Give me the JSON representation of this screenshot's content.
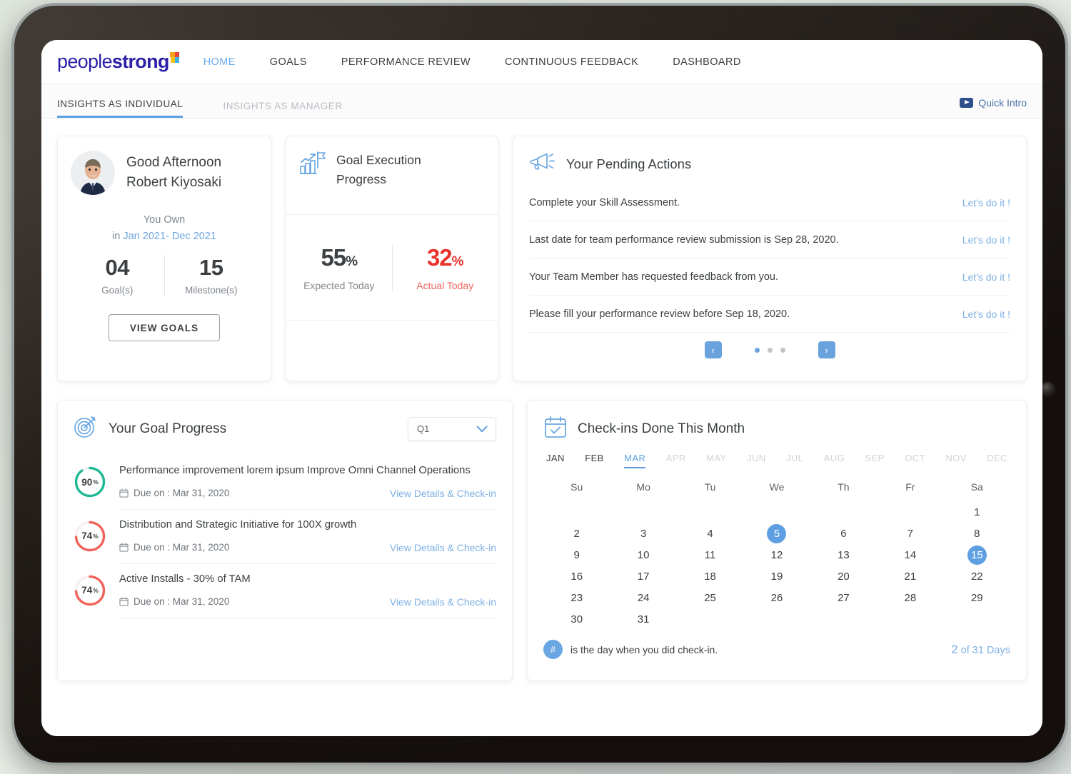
{
  "nav": {
    "logo": {
      "light": "people",
      "bold": "strong"
    },
    "items": [
      {
        "label": "HOME",
        "active": true
      },
      {
        "label": "GOALS",
        "active": false
      },
      {
        "label": "PERFORMANCE REVIEW",
        "active": false
      },
      {
        "label": "CONTINUOUS FEEDBACK",
        "active": false
      },
      {
        "label": "DASHBOARD",
        "active": false
      }
    ]
  },
  "subtabs": {
    "items": [
      {
        "label": "INSIGHTS AS INDIVIDUAL",
        "active": true
      },
      {
        "label": "INSIGHTS AS MANAGER",
        "active": false
      }
    ],
    "quick_intro": "Quick Intro"
  },
  "greeting": {
    "salutation": "Good Afternoon",
    "name": "Robert Kiyosaki",
    "you_own": "You Own",
    "period_prefix": "in ",
    "period": "Jan 2021- Dec 2021",
    "stats": [
      {
        "value": "04",
        "label": "Goal(s)"
      },
      {
        "value": "15",
        "label": "Milestone(s)"
      }
    ],
    "view_goals": "VIEW GOALS"
  },
  "goal_execution": {
    "title_line1": "Goal Execution",
    "title_line2": "Progress",
    "expected": {
      "value": "55",
      "pct": "%",
      "label": "Expected Today"
    },
    "actual": {
      "value": "32",
      "pct": "%",
      "label": "Actual Today",
      "color": "#e8322b"
    }
  },
  "pending_actions": {
    "title": "Your Pending Actions",
    "items": [
      {
        "text": "Complete your Skill Assessment.",
        "link": "Let's do it !"
      },
      {
        "text": "Last date for team performance review submission is Sep 28, 2020.",
        "link": "Let's do it !"
      },
      {
        "text": "Your Team Member has requested feedback from you.",
        "link": "Let's do it !"
      },
      {
        "text": "Please fill your performance review before Sep 18, 2020.",
        "link": "Let's do it !"
      }
    ],
    "prev": "‹",
    "next": "›",
    "dots": 3,
    "active_dot": 0
  },
  "goal_progress": {
    "title": "Your Goal Progress",
    "quarter": "Q1",
    "goals": [
      {
        "percent": 90,
        "percent_label": "90",
        "pct_sign": "%",
        "color": "#1fb894",
        "title": "Performance improvement lorem ipsum Improve Omni Channel Operations",
        "due": "Due on : Mar 31, 2020",
        "link": "View Details & Check-in"
      },
      {
        "percent": 74,
        "percent_label": "74",
        "pct_sign": "%",
        "color": "#f0635c",
        "title": "Distribution and Strategic Initiative for 100X growth",
        "due": "Due on : Mar 31, 2020",
        "link": "View Details & Check-in"
      },
      {
        "percent": 74,
        "percent_label": "74",
        "pct_sign": "%",
        "color": "#f0635c",
        "title": "Active Installs - 30% of TAM",
        "due": "Due on : Mar 31, 2020",
        "link": "View Details & Check-in"
      }
    ]
  },
  "checkins": {
    "title": "Check-ins Done This Month",
    "months": [
      {
        "label": "JAN",
        "state": "past"
      },
      {
        "label": "FEB",
        "state": "past"
      },
      {
        "label": "MAR",
        "state": "active"
      },
      {
        "label": "APR",
        "state": "future"
      },
      {
        "label": "MAY",
        "state": "future"
      },
      {
        "label": "JUN",
        "state": "future"
      },
      {
        "label": "JUL",
        "state": "future"
      },
      {
        "label": "AUG",
        "state": "future"
      },
      {
        "label": "SEP",
        "state": "future"
      },
      {
        "label": "OCT",
        "state": "future"
      },
      {
        "label": "NOV",
        "state": "future"
      },
      {
        "label": "DEC",
        "state": "future"
      }
    ],
    "weekdays": [
      "Su",
      "Mo",
      "Tu",
      "We",
      "Th",
      "Fr",
      "Sa"
    ],
    "leading_blanks": 6,
    "days_in_month": 31,
    "checked_days": [
      5,
      15
    ],
    "legend_symbol": "#",
    "legend_text": "is the day when you did check-in.",
    "count_number": "2",
    "count_suffix": " of 31 Days"
  },
  "colors": {
    "accent_blue": "#5d9fe0",
    "link_blue": "#7eb0e3",
    "brand_purple": "#2c1fa8",
    "green": "#1fb894",
    "red": "#e8322b",
    "coral": "#f0635c"
  }
}
